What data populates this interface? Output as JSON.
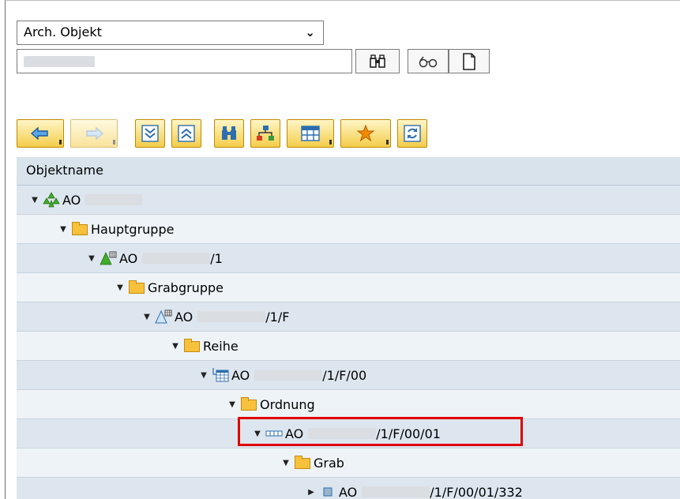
{
  "selector": {
    "type_value": "Arch. Objekt",
    "search_value": ""
  },
  "toolbar": {
    "icons": [
      "arrow-left-icon",
      "arrow-right-icon",
      "expand-all-icon",
      "collapse-all-icon",
      "find-icon",
      "hierarchy-icon",
      "layout-icon",
      "favorites-icon",
      "refresh-icon"
    ]
  },
  "tree": {
    "header": "Objektname",
    "rows": [
      {
        "label": "AO",
        "suffix": "",
        "icon": "archaeology-object-icon"
      },
      {
        "label": "Hauptgruppe",
        "suffix": "",
        "icon": "folder-icon"
      },
      {
        "label": "AO",
        "suffix": "/1",
        "icon": "main-group-icon"
      },
      {
        "label": "Grabgruppe",
        "suffix": "",
        "icon": "folder-icon"
      },
      {
        "label": "AO",
        "suffix": "/1/F",
        "icon": "grave-group-icon"
      },
      {
        "label": "Reihe",
        "suffix": "",
        "icon": "folder-icon"
      },
      {
        "label": "AO",
        "suffix": "/1/F/00",
        "icon": "row-icon"
      },
      {
        "label": "Ordnung",
        "suffix": "",
        "icon": "folder-icon"
      },
      {
        "label": "AO",
        "suffix": "/1/F/00/01",
        "icon": "order-icon"
      },
      {
        "label": "Grab",
        "suffix": "",
        "icon": "folder-icon"
      },
      {
        "label": "AO",
        "suffix": "/1/F/00/01/332",
        "icon": "grave-icon"
      }
    ]
  },
  "colors": {
    "highlight": "#e00000",
    "row_dark": "#dde6ee",
    "row_light": "#eef3f7",
    "folder": "#f7c13b",
    "toolbar": "#f4cd4b"
  }
}
